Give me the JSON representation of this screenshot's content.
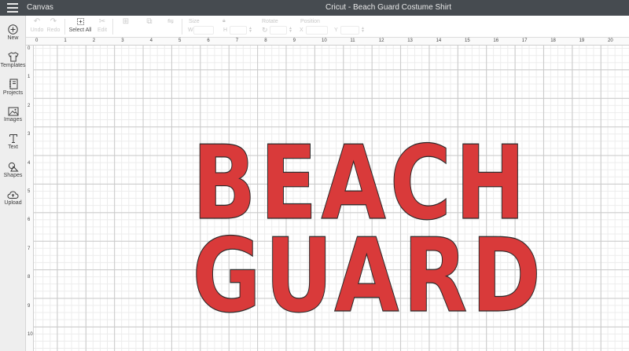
{
  "topbar": {
    "app_label": "Canvas",
    "title": "Cricut - Beach Guard Costume Shirt"
  },
  "toolbar": {
    "undo_label": "Undo",
    "redo_label": "Redo",
    "select_all_label": "Select All",
    "edit_label": "Edit",
    "size_label": "Size",
    "size_w": "W",
    "size_h": "H",
    "rotate_label": "Rotate",
    "position_label": "Position",
    "position_x": "X",
    "position_y": "Y"
  },
  "sidebar": {
    "items": [
      {
        "label": "New",
        "icon": "plus-circle-icon"
      },
      {
        "label": "Templates",
        "icon": "tshirt-icon"
      },
      {
        "label": "Projects",
        "icon": "notebook-icon"
      },
      {
        "label": "Images",
        "icon": "image-icon"
      },
      {
        "label": "Text",
        "icon": "text-icon"
      },
      {
        "label": "Shapes",
        "icon": "shapes-icon"
      },
      {
        "label": "Upload",
        "icon": "cloud-upload-icon"
      }
    ]
  },
  "ruler": {
    "top": [
      "0",
      "1",
      "2",
      "3",
      "4",
      "5",
      "6",
      "7",
      "8",
      "9",
      "10",
      "11",
      "12",
      "13",
      "14",
      "15",
      "16",
      "17",
      "18",
      "19",
      "20"
    ],
    "left": [
      "0",
      "1",
      "2",
      "3",
      "4",
      "5",
      "6",
      "7",
      "8",
      "9",
      "10"
    ]
  },
  "canvas": {
    "line1": "BEACH",
    "line2": "GUARD",
    "text_fill": "#d93a3a",
    "text_stroke": "#2b2b2b"
  }
}
